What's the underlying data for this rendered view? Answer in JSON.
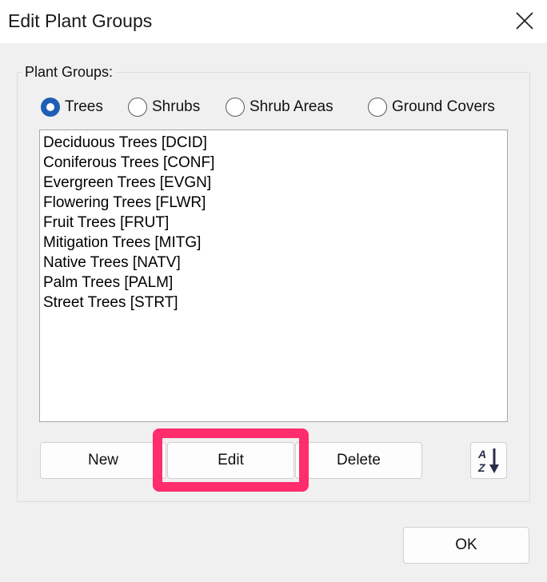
{
  "window": {
    "title": "Edit Plant Groups",
    "close_icon": "close-icon"
  },
  "group": {
    "label": "Plant Groups:",
    "radios": [
      {
        "label": "Trees",
        "checked": true
      },
      {
        "label": "Shrubs",
        "checked": false
      },
      {
        "label": "Shrub Areas",
        "checked": false
      },
      {
        "label": "Ground Covers",
        "checked": false
      }
    ],
    "items": [
      "Deciduous Trees [DCID]",
      "Coniferous Trees [CONF]",
      "Evergreen Trees [EVGN]",
      "Flowering Trees [FLWR]",
      "Fruit Trees [FRUT]",
      "Mitigation Trees [MITG]",
      "Native Trees [NATV]",
      "Palm Trees [PALM]",
      "Street Trees [STRT]"
    ],
    "buttons": {
      "new": "New",
      "edit": "Edit",
      "delete": "Delete",
      "sort_icon": "sort-az-icon"
    }
  },
  "footer": {
    "ok": "OK"
  },
  "colors": {
    "radio_checked": "#1f5fb5",
    "highlight": "#ff2d6b"
  }
}
